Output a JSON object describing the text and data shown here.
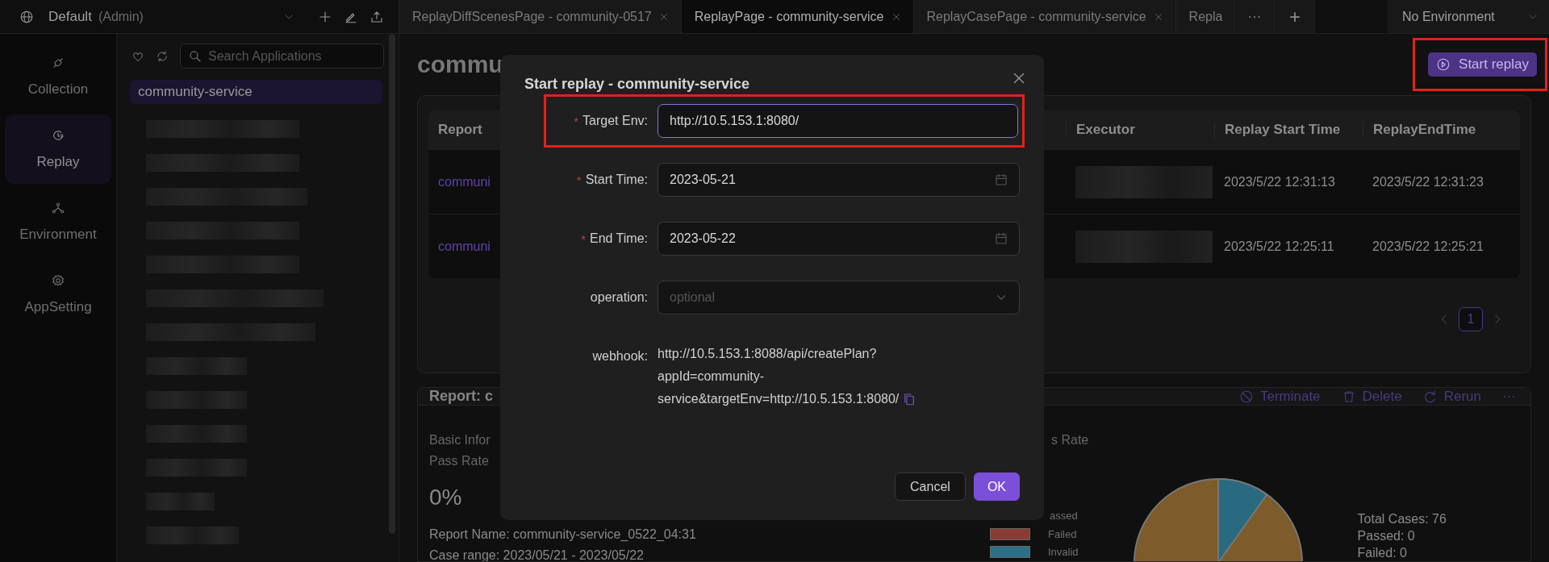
{
  "workspace": {
    "name": "Default",
    "role": "(Admin)"
  },
  "tabs": [
    {
      "label": "ReplayDiffScenesPage - community-0517",
      "selected": false,
      "closable": true
    },
    {
      "label": "ReplayPage - community-service",
      "selected": true,
      "closable": true
    },
    {
      "label": "ReplayCasePage - community-service",
      "selected": false,
      "closable": true
    },
    {
      "label": "Repla",
      "selected": false,
      "closable": false
    }
  ],
  "tab_overflow": "···",
  "add_tab": "+",
  "environment": "No Environment",
  "nav": [
    {
      "label": "Collection",
      "selected": false
    },
    {
      "label": "Replay",
      "selected": true
    },
    {
      "label": "Environment",
      "selected": false
    },
    {
      "label": "AppSetting",
      "selected": false
    }
  ],
  "app_search": {
    "placeholder": "Search Applications"
  },
  "apps": [
    {
      "label": "community-service",
      "selected": true
    }
  ],
  "page": {
    "title": "commu",
    "start_button": "Start replay"
  },
  "table": {
    "columns": [
      "Report",
      "Executor",
      "Replay Start Time",
      "ReplayEndTime"
    ],
    "rows": [
      {
        "report": "communi",
        "start": "2023/5/22 12:31:13",
        "end": "2023/5/22 12:31:23"
      },
      {
        "report": "communi",
        "start": "2023/5/22 12:25:11",
        "end": "2023/5/22 12:25:21"
      }
    ]
  },
  "pagination": {
    "pages": [
      {
        "label": "1",
        "selected": true
      }
    ]
  },
  "report": {
    "title": "Report: c",
    "actions": [
      {
        "label": "Terminate"
      },
      {
        "label": "Delete"
      },
      {
        "label": "Rerun"
      }
    ],
    "more": "···",
    "basic_info": "Basic Infor",
    "pass_rate_label": "Pass Rate",
    "pass_rate": "0%",
    "report_name": "Report Name: community-service_0522_04:31",
    "case_range": "Case range: 2023/05/21 - 2023/05/22",
    "chart_title": "s Rate",
    "legend": [
      {
        "label": "assed"
      },
      {
        "label": "Failed",
        "color": "#8a3b34"
      },
      {
        "label": "Invalid",
        "color": "#2d6f86"
      }
    ],
    "totals": [
      "Total Cases: 76",
      "Passed: 0",
      "Failed: 0"
    ]
  },
  "dialog": {
    "title": "Start replay - community-service",
    "fields": [
      {
        "kind": "text",
        "mark": "*",
        "label": "Target Env:",
        "value": "http://10.5.153.1:8080/",
        "focused": true
      },
      {
        "kind": "date",
        "mark": "*",
        "label": "Start Time:",
        "value": "2023-05-21",
        "focused": false
      },
      {
        "kind": "date",
        "mark": "*",
        "label": "End Time:",
        "value": "2023-05-22",
        "focused": false
      },
      {
        "kind": "select",
        "label": "operation:",
        "placeholder": "optional",
        "focused": false
      },
      {
        "kind": "info",
        "label": "webhook:",
        "lines": [
          "http://10.5.153.1:8088/api/createPlan?",
          "appId=community-",
          "service&targetEnv=http://10.5.153.1:8080/"
        ]
      }
    ],
    "buttons": [
      {
        "label": "Cancel",
        "primary": false
      },
      {
        "label": "OK",
        "primary": true
      }
    ]
  }
}
